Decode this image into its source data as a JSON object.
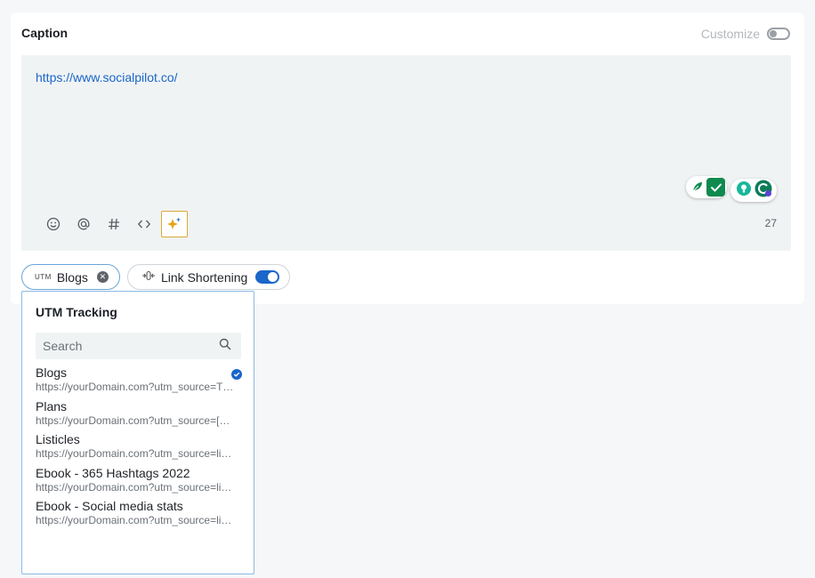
{
  "caption": {
    "label": "Caption",
    "customize_label": "Customize"
  },
  "editor": {
    "text": "https://www.socialpilot.co/",
    "char_count": "27"
  },
  "chips": {
    "utm_tag": "UTM",
    "utm_label": "Blogs",
    "link_shortening_label": "Link Shortening"
  },
  "utm_dropdown": {
    "title": "UTM Tracking",
    "search_placeholder": "Search",
    "items": [
      {
        "name": "Blogs",
        "url": "https://yourDomain.com?utm_source=T…",
        "selected": true
      },
      {
        "name": "Plans",
        "url": "https://yourDomain.com?utm_source=[…",
        "selected": false
      },
      {
        "name": "Listicles",
        "url": "https://yourDomain.com?utm_source=li…",
        "selected": false
      },
      {
        "name": "Ebook - 365 Hashtags 2022",
        "url": "https://yourDomain.com?utm_source=li…",
        "selected": false
      },
      {
        "name": "Ebook - Social media stats",
        "url": "https://yourDomain.com?utm_source=li…",
        "selected": false
      }
    ]
  },
  "colors": {
    "accent": "#1a66c9",
    "grammar_green": "#0f8a4e",
    "ai_border": "#d8a838"
  },
  "icons": {
    "toolbar": [
      "emoji-icon",
      "mention-icon",
      "hashtag-icon",
      "code-icon",
      "ai-sparkle-icon"
    ]
  }
}
